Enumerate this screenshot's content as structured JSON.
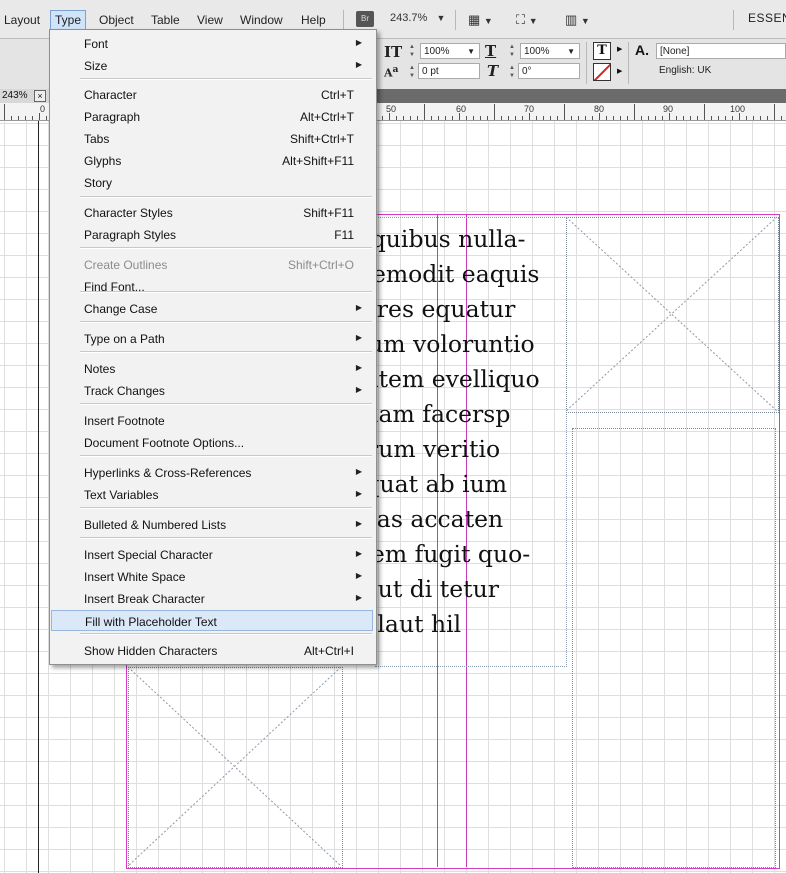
{
  "menubar": {
    "items": [
      "Layout",
      "Type",
      "Object",
      "Table",
      "View",
      "Window",
      "Help"
    ],
    "bridge_label": "Br",
    "zoom": "243.7%",
    "workspace": "ESSENT"
  },
  "control": {
    "vscale": "100%",
    "hscale": "100%",
    "baseline": "0 pt",
    "skew": "0°",
    "char_style": "[None]",
    "language": "English: UK"
  },
  "tab": {
    "zoom": "243%",
    "close": "×"
  },
  "ruler": {
    "labels": [
      "0",
      "50",
      "60",
      "70",
      "80",
      "90",
      "100"
    ]
  },
  "text_lines": [
    "m quibus nulla-",
    "latemodit eaquis",
    "olores equatur",
    "ecum voloruntio",
    "otatem evelliquo",
    ", illam facersp",
    "serum veritio",
    "atquat ab ium",
    "ucias accaten",
    "r rem fugit quo-",
    "dolut di tetur",
    "e plaut hil"
  ],
  "type_menu": {
    "items": [
      {
        "label": "Font",
        "shortcut": "",
        "submenu": true
      },
      {
        "label": "Size",
        "shortcut": "",
        "submenu": true
      },
      {
        "label": "Character",
        "shortcut": "Ctrl+T",
        "submenu": false
      },
      {
        "label": "Paragraph",
        "shortcut": "Alt+Ctrl+T",
        "submenu": false
      },
      {
        "label": "Tabs",
        "shortcut": "Shift+Ctrl+T",
        "submenu": false
      },
      {
        "label": "Glyphs",
        "shortcut": "Alt+Shift+F11",
        "submenu": false
      },
      {
        "label": "Story",
        "shortcut": "",
        "submenu": false
      },
      {
        "label": "Character Styles",
        "shortcut": "Shift+F11",
        "submenu": false
      },
      {
        "label": "Paragraph Styles",
        "shortcut": "F11",
        "submenu": false
      },
      {
        "label": "Create Outlines",
        "shortcut": "Shift+Ctrl+O",
        "submenu": false,
        "disabled": true
      },
      {
        "label": "Find Font...",
        "shortcut": "",
        "submenu": false
      },
      {
        "label": "Change Case",
        "shortcut": "",
        "submenu": true
      },
      {
        "label": "Type on a Path",
        "shortcut": "",
        "submenu": true
      },
      {
        "label": "Notes",
        "shortcut": "",
        "submenu": true
      },
      {
        "label": "Track Changes",
        "shortcut": "",
        "submenu": true
      },
      {
        "label": "Insert Footnote",
        "shortcut": "",
        "submenu": false
      },
      {
        "label": "Document Footnote Options...",
        "shortcut": "",
        "submenu": false
      },
      {
        "label": "Hyperlinks & Cross-References",
        "shortcut": "",
        "submenu": true
      },
      {
        "label": "Text Variables",
        "shortcut": "",
        "submenu": true
      },
      {
        "label": "Bulleted & Numbered Lists",
        "shortcut": "",
        "submenu": true
      },
      {
        "label": "Insert Special Character",
        "shortcut": "",
        "submenu": true
      },
      {
        "label": "Insert White Space",
        "shortcut": "",
        "submenu": true
      },
      {
        "label": "Insert Break Character",
        "shortcut": "",
        "submenu": true
      },
      {
        "label": "Fill with Placeholder Text",
        "shortcut": "",
        "submenu": false,
        "highlighted": true
      },
      {
        "label": "Show Hidden Characters",
        "shortcut": "Alt+Ctrl+I",
        "submenu": false
      }
    ]
  }
}
